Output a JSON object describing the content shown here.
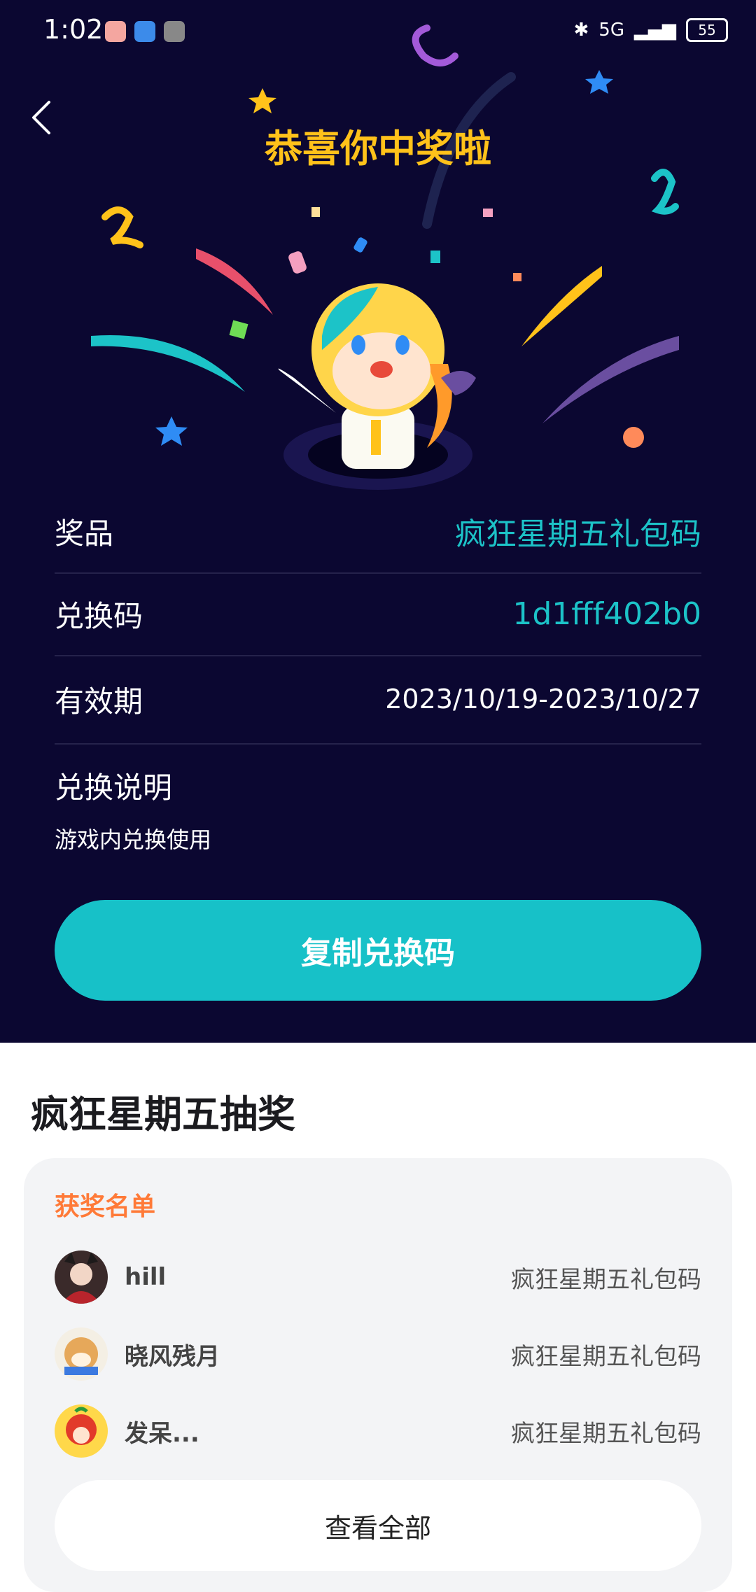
{
  "status_bar": {
    "time": "1:02",
    "battery": "55",
    "signal_text": "5G"
  },
  "hero": {
    "title": "恭喜你中奖啦"
  },
  "prize": {
    "prize_label": "奖品",
    "prize_value": "疯狂星期五礼包码",
    "code_label": "兑换码",
    "code_value": "1d1fff402b0",
    "validity_label": "有效期",
    "validity_value": "2023/10/19-2023/10/27",
    "instructions_label": "兑换说明",
    "instructions_text": "游戏内兑换使用"
  },
  "copy_button_label": "复制兑换码",
  "lottery": {
    "title": "疯狂星期五抽奖",
    "winners_header": "获奖名单",
    "winners": [
      {
        "name": "hill",
        "prize": "疯狂星期五礼包码"
      },
      {
        "name": "晓风残月",
        "prize": "疯狂星期五礼包码"
      },
      {
        "name": "发呆...",
        "prize": "疯狂星期五礼包码"
      }
    ],
    "view_all_label": "查看全部"
  },
  "colors": {
    "hero_bg": "#0b0731",
    "accent_teal": "#17c1c8",
    "title_gold": "#ffc21a",
    "winners_header": "#ff7a38"
  }
}
